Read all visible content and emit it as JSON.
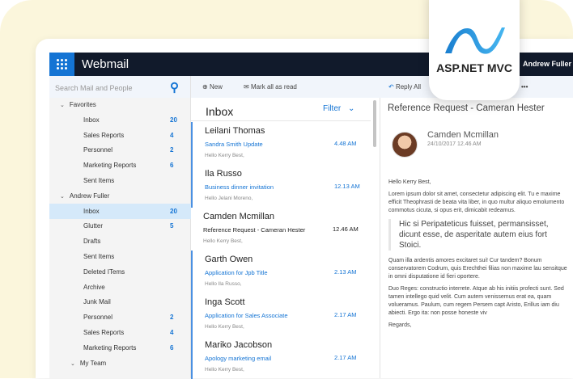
{
  "brand": {
    "logo_text": "ASP.NET MVC",
    "accent": "#1474d4"
  },
  "header": {
    "title": "Webmail",
    "user": "Andrew Fuller"
  },
  "search": {
    "placeholder": "Search Mail and People"
  },
  "sidebar": {
    "rows": [
      {
        "label": "Favorites",
        "group": true
      },
      {
        "label": "Inbox",
        "count": "20"
      },
      {
        "label": "Sales Reports",
        "count": "4"
      },
      {
        "label": "Personnel",
        "count": "2"
      },
      {
        "label": "Marketing Reports",
        "count": "6"
      },
      {
        "label": "Sent Items"
      },
      {
        "label": "Andrew Fuller",
        "group": true
      },
      {
        "label": "Inbox",
        "count": "20",
        "selected": true
      },
      {
        "label": "Glutter",
        "count": "5"
      },
      {
        "label": "Drafts"
      },
      {
        "label": "Sent Items"
      },
      {
        "label": "Deleted ITems"
      },
      {
        "label": "Archive"
      },
      {
        "label": "Junk Mail"
      },
      {
        "label": "Personnel",
        "count": "2"
      },
      {
        "label": "Sales Reports",
        "count": "4"
      },
      {
        "label": "Marketing Reports",
        "count": "6"
      },
      {
        "label": "My Team",
        "group": true,
        "sub": true
      }
    ]
  },
  "toolbar": {
    "new": "New",
    "mark_all": "Mark all as read",
    "reply_all": "Reply All",
    "more": "•••"
  },
  "list": {
    "title": "Inbox",
    "filter": "Filter",
    "items": [
      {
        "name": "Leilani Thomas",
        "subject": "Sandra Smith Update",
        "time": "4.48 AM",
        "preview": "Hello Kerry Best,",
        "unread": true
      },
      {
        "name": "Ila Russo",
        "subject": "Business dinner invitation",
        "time": "12.13 AM",
        "preview": "Hello Jelani Moreno,",
        "unread": true
      },
      {
        "name": "Camden Mcmillan",
        "subject": "Reference Request - Cameran Hester",
        "time": "12.46 AM",
        "preview": "Hello Kerry Best,",
        "unread": false
      },
      {
        "name": "Garth Owen",
        "subject": "Application for Jpb Title",
        "time": "2.13 AM",
        "preview": "Hello Ila Russo,",
        "unread": true
      },
      {
        "name": "Inga Scott",
        "subject": "Application for Sales Associate",
        "time": "2.17 AM",
        "preview": "Hello Kerry Best,",
        "unread": true
      },
      {
        "name": "Mariko Jacobson",
        "subject": "Apology marketing email",
        "time": "2.17 AM",
        "preview": "Hello Kerry Best,",
        "unread": true
      }
    ]
  },
  "reading": {
    "subject": "Reference Request - Cameran Hester",
    "from": "Camden Mcmillan",
    "date": "24/10/2017 12.46 AM",
    "greeting": "Hello Kerry Best,",
    "p1": [
      "Lorem ipsum dolor sit amet, consectetur adipiscing elit. Tu e",
      "maxime efficit Theophrasti de beata vita liber, in quo multur",
      "aliquo emolumento commotus cicuta, si opus erit, dimicabit",
      "redeamus."
    ],
    "quote": [
      "Hic si Peripateticus fuisset, permansisset,",
      "dicunt esse, de asperitate autem eius fort",
      "Stoici."
    ],
    "p2": [
      "Quam illa ardentis amores excitaret sui! Cur tandem? Bonum",
      "conservatorem Codrum, quis Erechthei filias non maxime lau",
      "sensitque in omni disputatione id fieri oportere."
    ],
    "p3": [
      "Duo Reges: constructio interrete. Atque ab his initiis profecti",
      "sunt. Sed tamen intellego quid velit. Cum autem venissemus",
      "erat ea, quam volueramus. Paulum, cum regem Persem capt",
      "Aristo, Erillus iam diu abiecti. Ergo ita: non posse honeste viv"
    ],
    "closing": "Regards,"
  }
}
